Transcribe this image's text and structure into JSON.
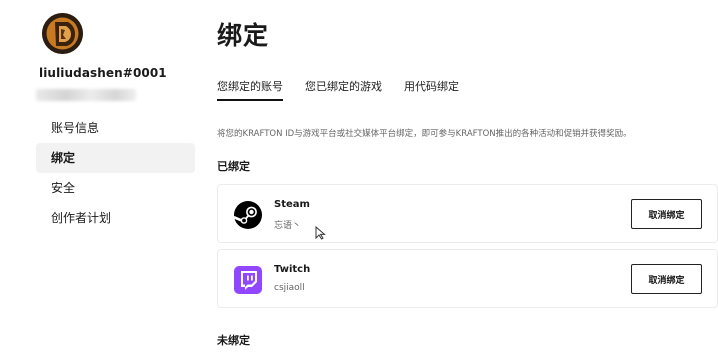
{
  "user": {
    "username": "liuliudashen#0001"
  },
  "sidebar": {
    "items": [
      {
        "label": "账号信息"
      },
      {
        "label": "绑定"
      },
      {
        "label": "安全"
      },
      {
        "label": "创作者计划"
      }
    ]
  },
  "main": {
    "title": "绑定",
    "tabs": [
      {
        "label": "您绑定的账号"
      },
      {
        "label": "您已绑定的游戏"
      },
      {
        "label": "用代码绑定"
      }
    ],
    "description": "将您的KRAFTON ID与游戏平台或社交媒体平台绑定，即可参与KRAFTON推出的各种活动和促销并获得奖励。",
    "bound_section_title": "已绑定",
    "unbound_section_title": "未绑定",
    "bound_accounts": [
      {
        "platform": "Steam",
        "account": "忘语丶",
        "button": "取消绑定",
        "icon": "steam-icon"
      },
      {
        "platform": "Twitch",
        "account": "csjiaoll",
        "button": "取消绑定",
        "icon": "twitch-icon"
      }
    ]
  },
  "colors": {
    "twitch": "#9146ff",
    "steam": "#000000",
    "active_nav_bg": "#f2f2f2"
  }
}
